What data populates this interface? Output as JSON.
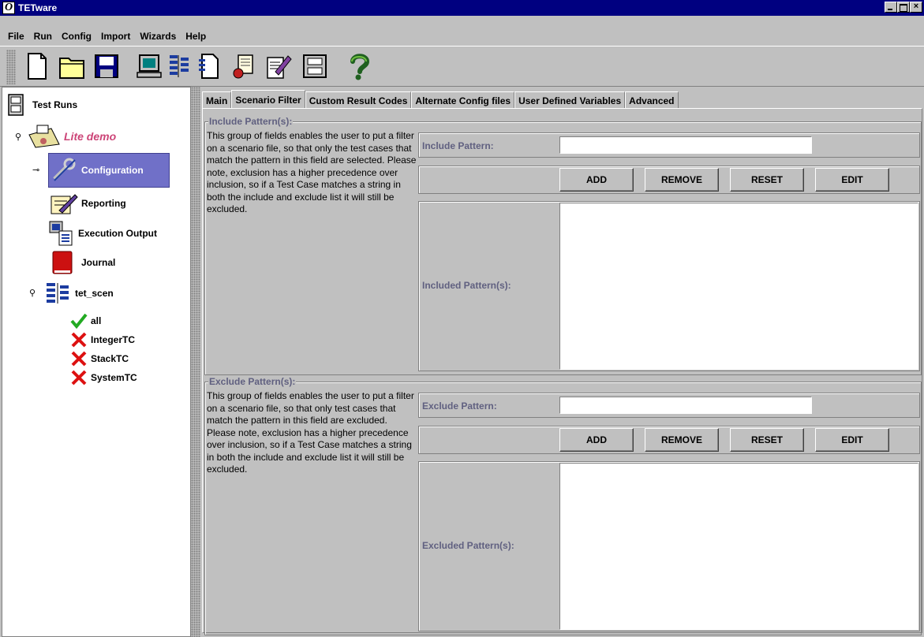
{
  "window": {
    "title": "TETware",
    "logo_glyph": "O",
    "close_glyph": "×"
  },
  "menu": [
    "File",
    "Run",
    "Config",
    "Import",
    "Wizards",
    "Help"
  ],
  "toolbar": [
    "new-file-icon",
    "open-folder-icon",
    "save-disk-icon",
    "computer-icon",
    "scenario-icon",
    "document-icon",
    "journal-icon",
    "edit-document-icon",
    "printer-icon",
    "help-icon"
  ],
  "tree": {
    "root": "Test Runs",
    "run": "Lite demo",
    "configuration": "Configuration",
    "reporting": "Reporting",
    "execution_output": "Execution Output",
    "journal": "Journal",
    "scenario": "tet_scen",
    "cases": [
      {
        "label": "all",
        "status": "pass"
      },
      {
        "label": "IntegerTC",
        "status": "fail"
      },
      {
        "label": "StackTC",
        "status": "fail"
      },
      {
        "label": "SystemTC",
        "status": "fail"
      }
    ]
  },
  "tabs": [
    "Main",
    "Scenario Filter",
    "Custom Result Codes",
    "Alternate Config files",
    "User Defined Variables",
    "Advanced"
  ],
  "active_tab": "Scenario Filter",
  "include": {
    "group_title": "Include Pattern(s):",
    "description": "This group of fields enables the user to put a filter on a scenario file, so that only the test cases that match the pattern in this field are selected.  Please note, exclusion has a higher precedence over inclusion, so if a Test Case matches a string in both the include and exclude list it will still be excluded.",
    "pattern_label": "Include Pattern:",
    "pattern_value": "",
    "list_label": "Included Pattern(s):"
  },
  "exclude": {
    "group_title": "Exclude Pattern(s):",
    "description": "This group of fields enables the user to put a filter on a scenario file, so that only test cases that match the pattern in this field are excluded. Please note, exclusion has a higher precedence over inclusion, so if a Test Case matches a string in both the include and exclude list it will still be excluded.",
    "pattern_label": "Exclude Pattern:",
    "pattern_value": "",
    "list_label": "Excluded Pattern(s):"
  },
  "buttons": {
    "add": "ADD",
    "remove": "REMOVE",
    "reset": "RESET",
    "edit": "EDIT"
  },
  "colors": {
    "title_bar": "#000080",
    "selection": "#7070c8",
    "run_label": "#cc4477",
    "group_label": "#606080",
    "pass": "#22aa22",
    "fail": "#dd1111"
  }
}
